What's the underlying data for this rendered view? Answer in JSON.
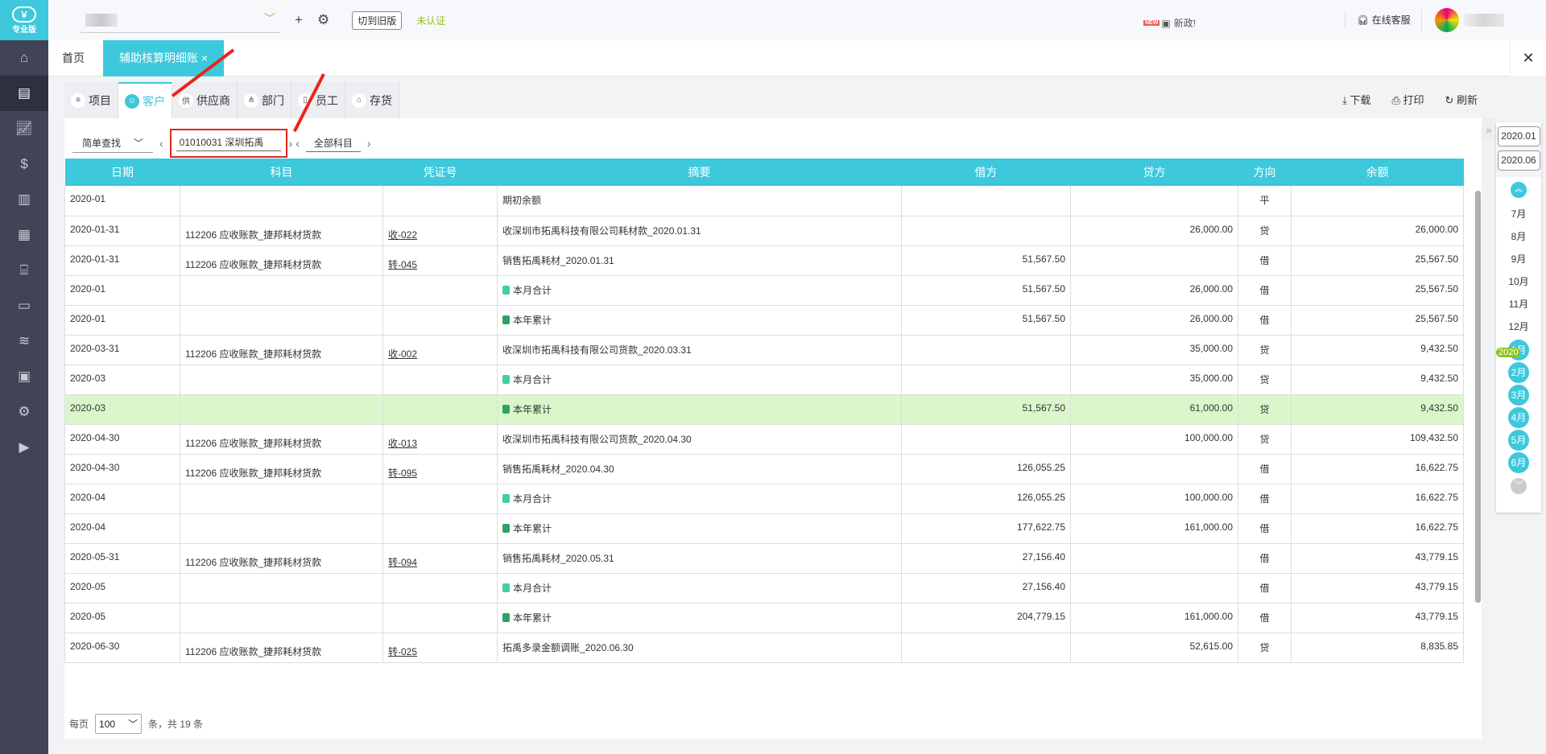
{
  "logo": {
    "label": "专业版"
  },
  "sidebar": {
    "icons": [
      "home-icon",
      "voucher-icon",
      "chart-icon",
      "money-bag-icon",
      "book-icon",
      "report-icon",
      "store-icon",
      "invoice-icon",
      "coins-icon",
      "tax-icon",
      "settings-icon",
      "video-icon"
    ]
  },
  "topbar": {
    "switch_old": "切到旧版",
    "unverified": "未认证",
    "news_badge": "NEW",
    "news": "新政!",
    "service": "在线客服"
  },
  "tabs": {
    "home": "首页",
    "active": "辅助核算明细账",
    "close": "×",
    "close_all": "✕"
  },
  "subtabs": [
    {
      "label": "项目",
      "icon": "≡"
    },
    {
      "label": "客户",
      "icon": "☺"
    },
    {
      "label": "供应商",
      "icon": "供"
    },
    {
      "label": "部门",
      "icon": "⋔"
    },
    {
      "label": "员工",
      "icon": "▯"
    },
    {
      "label": "存货",
      "icon": "⌂"
    }
  ],
  "actions": {
    "download": "下载",
    "print": "打印",
    "refresh": "刷新"
  },
  "filter": {
    "mode": "简单查找",
    "customer": "01010031  深圳拓禹",
    "subject": "全部科目"
  },
  "table": {
    "headers": [
      "日期",
      "科目",
      "凭证号",
      "摘要",
      "借方",
      "贷方",
      "方向",
      "余额"
    ],
    "rows": [
      [
        "2020-01",
        "",
        "",
        "期初余额",
        "",
        "",
        "平",
        ""
      ],
      [
        "2020-01-31",
        "112206 应收账款_捷邦耗材货款",
        "收-022",
        "收深圳市拓禹科技有限公司耗材款_2020.01.31",
        "",
        "26,000.00",
        "贷",
        "26,000.00"
      ],
      [
        "2020-01-31",
        "112206 应收账款_捷邦耗材货款",
        "转-045",
        "销售拓禹耗材_2020.01.31",
        "51,567.50",
        "",
        "借",
        "25,567.50"
      ],
      [
        "2020-01",
        "",
        "",
        "本月合计",
        "51,567.50",
        "26,000.00",
        "借",
        "25,567.50"
      ],
      [
        "2020-01",
        "",
        "",
        "本年累计",
        "51,567.50",
        "26,000.00",
        "借",
        "25,567.50"
      ],
      [
        "2020-03-31",
        "112206 应收账款_捷邦耗材货款",
        "收-002",
        "收深圳市拓禹科技有限公司货款_2020.03.31",
        "",
        "35,000.00",
        "贷",
        "9,432.50"
      ],
      [
        "2020-03",
        "",
        "",
        "本月合计",
        "",
        "35,000.00",
        "贷",
        "9,432.50"
      ],
      [
        "2020-03",
        "",
        "",
        "本年累计",
        "51,567.50",
        "61,000.00",
        "贷",
        "9,432.50"
      ],
      [
        "2020-04-30",
        "112206 应收账款_捷邦耗材货款",
        "收-013",
        "收深圳市拓禹科技有限公司货款_2020.04.30",
        "",
        "100,000.00",
        "贷",
        "109,432.50"
      ],
      [
        "2020-04-30",
        "112206 应收账款_捷邦耗材货款",
        "转-095",
        "销售拓禹耗材_2020.04.30",
        "126,055.25",
        "",
        "借",
        "16,622.75"
      ],
      [
        "2020-04",
        "",
        "",
        "本月合计",
        "126,055.25",
        "100,000.00",
        "借",
        "16,622.75"
      ],
      [
        "2020-04",
        "",
        "",
        "本年累计",
        "177,622.75",
        "161,000.00",
        "借",
        "16,622.75"
      ],
      [
        "2020-05-31",
        "112206 应收账款_捷邦耗材货款",
        "转-094",
        "销售拓禹耗材_2020.05.31",
        "27,156.40",
        "",
        "借",
        "43,779.15"
      ],
      [
        "2020-05",
        "",
        "",
        "本月合计",
        "27,156.40",
        "",
        "借",
        "43,779.15"
      ],
      [
        "2020-05",
        "",
        "",
        "本年累计",
        "204,779.15",
        "161,000.00",
        "借",
        "43,779.15"
      ],
      [
        "2020-06-30",
        "112206 应收账款_捷邦耗材货款",
        "转-025",
        "拓禹多录金额调账_2020.06.30",
        "",
        "52,615.00",
        "贷",
        "8,835.85"
      ]
    ]
  },
  "pager": {
    "per_page": "每页",
    "size": "100",
    "total": "条，共 19 条"
  },
  "period": {
    "start": "2020.01",
    "end": "2020.06",
    "year": "2020",
    "months": [
      "7月",
      "8月",
      "9月",
      "10月",
      "11月",
      "12月"
    ],
    "selected": [
      "1月",
      "2月",
      "3月",
      "4月",
      "5月",
      "6月"
    ]
  },
  "colors": {
    "accent": "#3ec8dc",
    "highlight": "#daf7cb",
    "sidebar": "#414356"
  }
}
